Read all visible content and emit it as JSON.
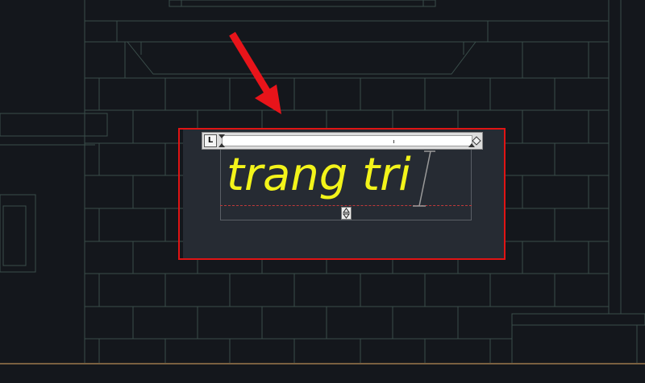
{
  "ruler": {
    "tab_type_label": "L"
  },
  "editor": {
    "text": "trang tri",
    "text_color": "#f3f41a",
    "background_color": "#262b33"
  },
  "highlight": {
    "color": "#e01414"
  },
  "icons": {
    "resize_handle": "up-down-arrows-icon",
    "pointer": "red-arrow-icon",
    "cursor": "text-i-beam-icon"
  }
}
